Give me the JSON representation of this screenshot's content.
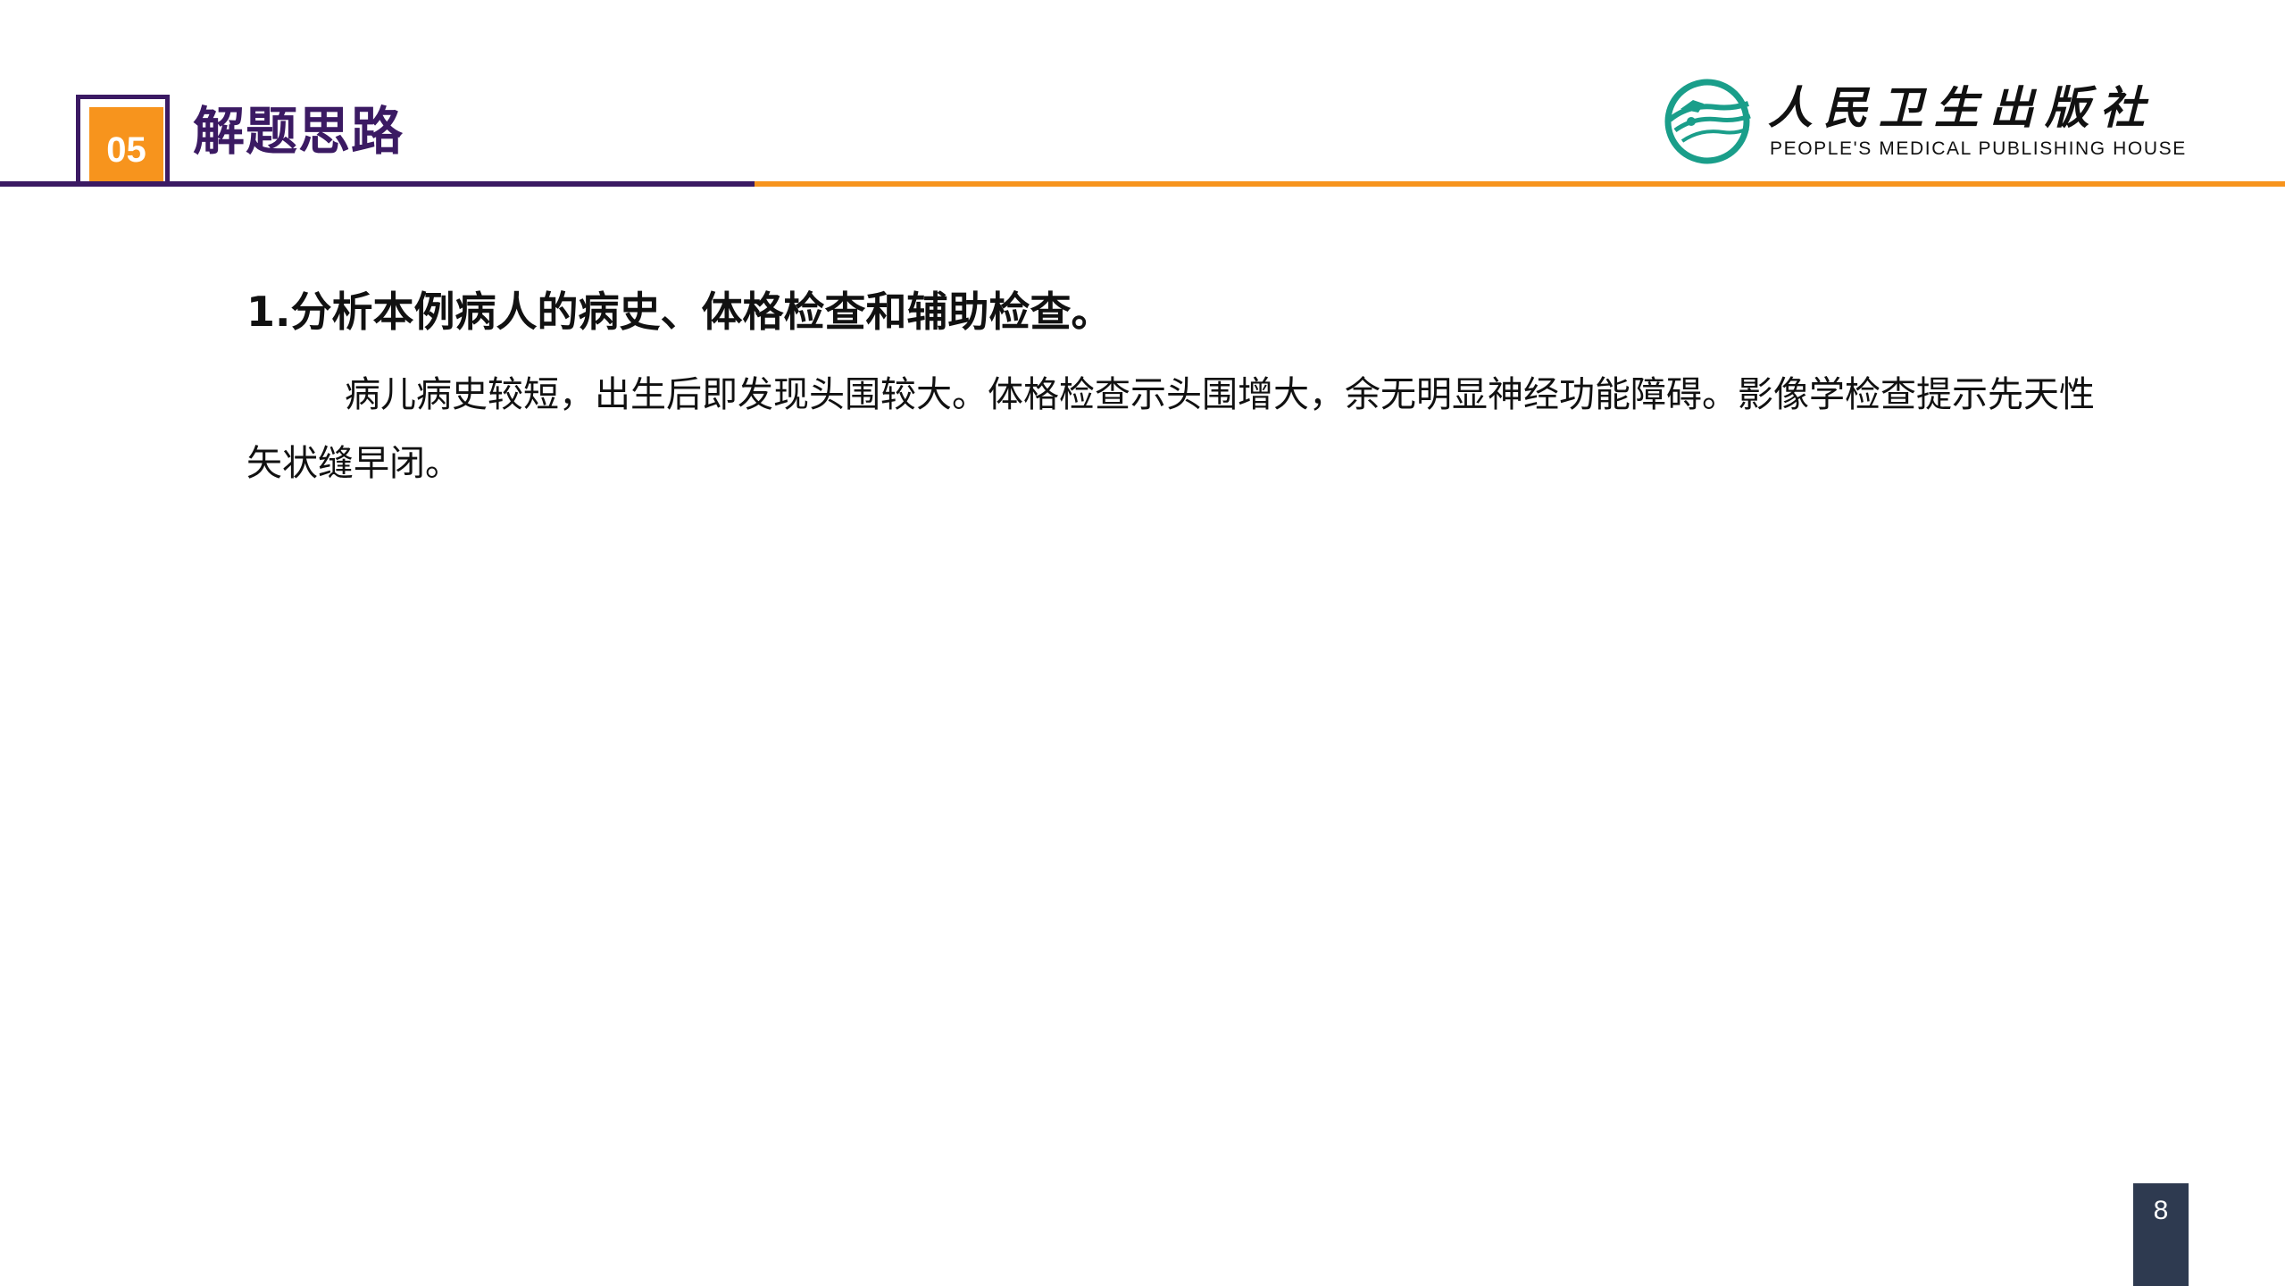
{
  "header": {
    "section_number": "05",
    "section_title": "解题思路"
  },
  "logo": {
    "name_cn": "人民卫生出版社",
    "name_en": "PEOPLE'S MEDICAL PUBLISHING HOUSE"
  },
  "content": {
    "heading": "1.分析本例病人的病史、体格检查和辅助检查。",
    "paragraph": "病儿病史较短，出生后即发现头围较大。体格检查示头围增大，余无明显神经功能障碍。影像学检查提示先天性矢状缝早闭。"
  },
  "footer": {
    "page_number": "8"
  },
  "colors": {
    "accent_dark": "#3b1a63",
    "accent_orange": "#f7941d",
    "logo_teal": "#1a9e8a",
    "page_badge": "#2e3a50"
  }
}
